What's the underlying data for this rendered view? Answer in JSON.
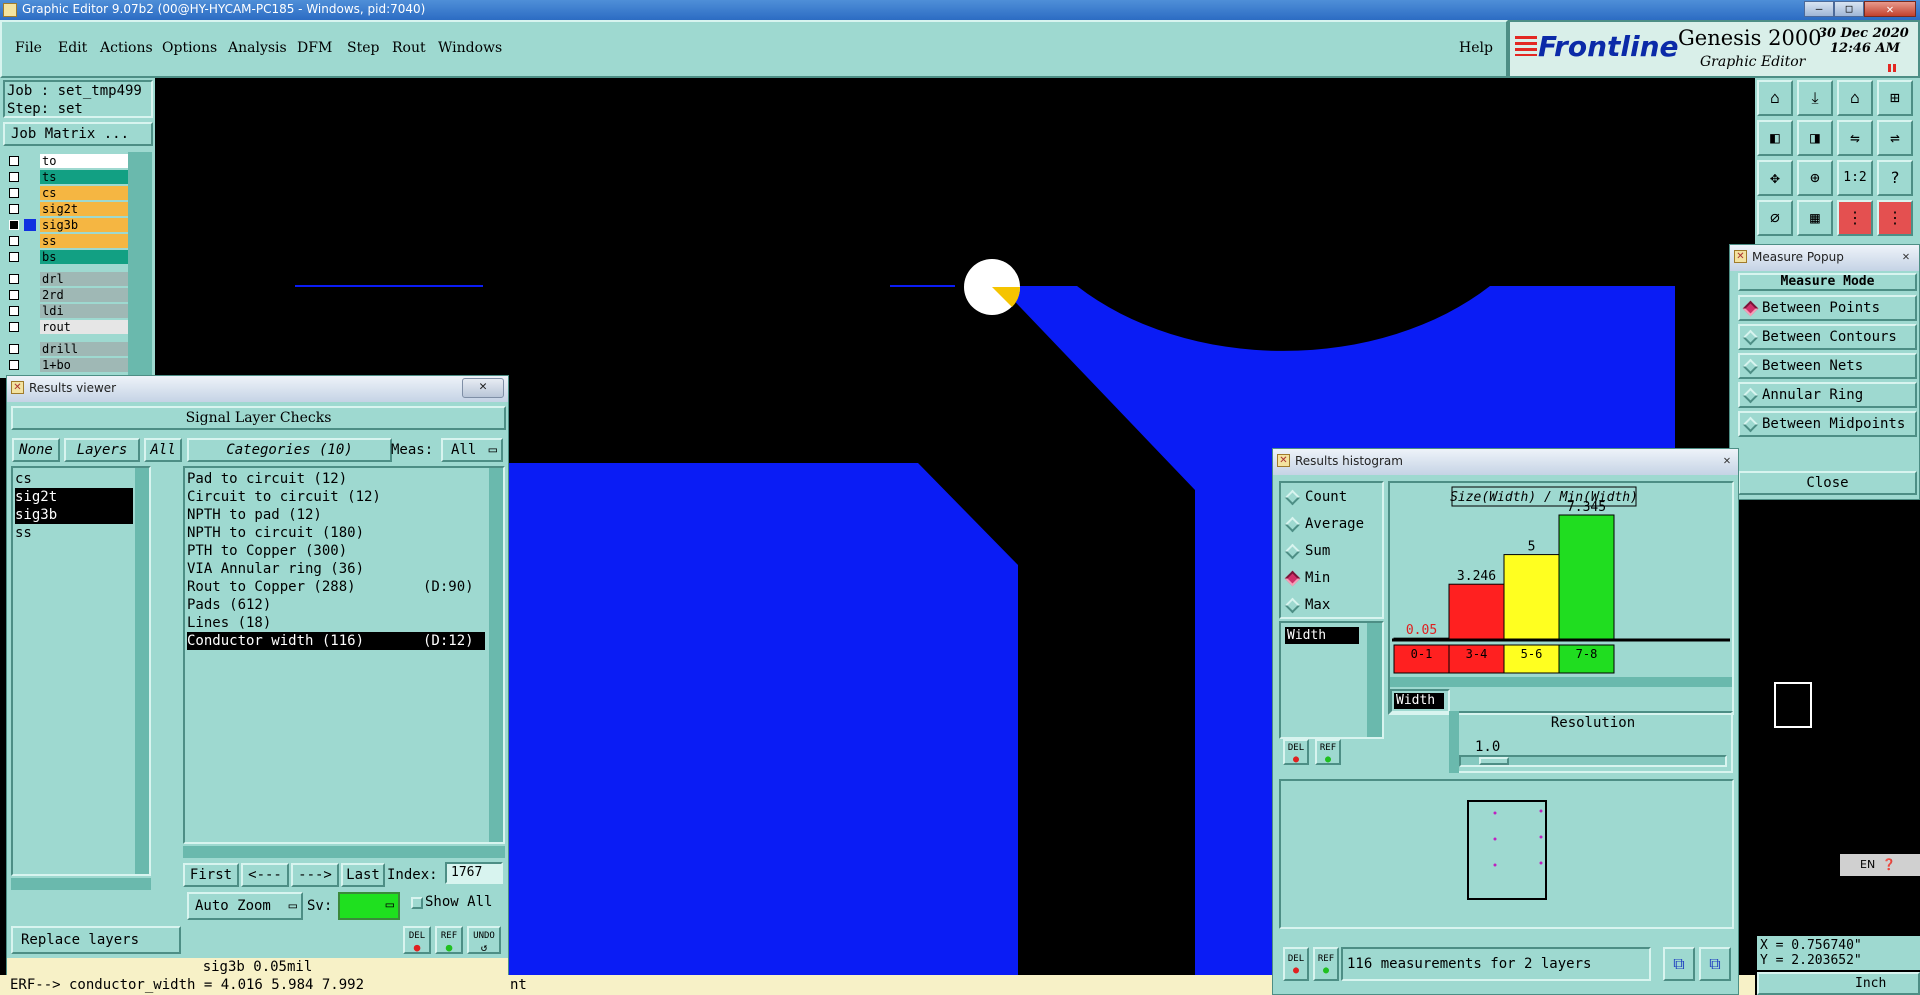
{
  "window_title": "Graphic Editor 9.07b2 (00@HY-HYCAM-PC185 - Windows, pid:7040)",
  "menu": [
    "File",
    "Edit",
    "Actions",
    "Options",
    "Analysis",
    "DFM",
    "Step",
    "Rout",
    "Windows"
  ],
  "help_label": "Help",
  "brand": {
    "logo": "Frontline",
    "product": "Genesis 2000",
    "subtitle": "Graphic Editor",
    "date": "30 Dec 2020",
    "time": "12:46 AM"
  },
  "job": {
    "job_label": "Job : set_tmp499",
    "step_label": "Step: set",
    "matrix_button": "Job Matrix ..."
  },
  "layers": [
    {
      "name": "to",
      "color": "#ffffff"
    },
    {
      "name": "ts",
      "color": "#12a083"
    },
    {
      "name": "cs",
      "color": "#f5b642"
    },
    {
      "name": "sig2t",
      "color": "#f5b642"
    },
    {
      "name": "sig3b",
      "color": "#f5b642",
      "active": true
    },
    {
      "name": "ss",
      "color": "#f5b642"
    },
    {
      "name": "bs",
      "color": "#12a083"
    },
    {
      "name": "drl",
      "color": "#9fb8b5"
    },
    {
      "name": "2rd",
      "color": "#9fb8b5"
    },
    {
      "name": "ldi",
      "color": "#9fb8b5"
    },
    {
      "name": "rout",
      "color": "#e6e6e6"
    },
    {
      "name": "drill",
      "color": "#9fb8b5"
    },
    {
      "name": "1+bo",
      "color": "#9fb8b5"
    }
  ],
  "results_viewer": {
    "title": "Results viewer",
    "header": "Signal Layer Checks",
    "none_btn": "None",
    "layers_btn": "Layers",
    "all_btn": "All",
    "categories_btn": "Categories (10)",
    "meas_label": "Meas:",
    "meas_value": "All",
    "layer_list": [
      "cs",
      "sig2t",
      "sig3b",
      "ss"
    ],
    "categories": [
      {
        "label": "Pad to circuit (12)",
        "extra": ""
      },
      {
        "label": "Circuit to circuit (12)",
        "extra": ""
      },
      {
        "label": "NPTH to pad (12)",
        "extra": ""
      },
      {
        "label": "NPTH to circuit (180)",
        "extra": ""
      },
      {
        "label": "PTH to Copper (300)",
        "extra": ""
      },
      {
        "label": "VIA Annular ring (36)",
        "extra": ""
      },
      {
        "label": "Rout to Copper (288)",
        "extra": "(D:90)"
      },
      {
        "label": "Pads (612)",
        "extra": ""
      },
      {
        "label": "Lines (18)",
        "extra": ""
      },
      {
        "label": "Conductor width (116)",
        "extra": "(D:12)"
      }
    ],
    "first": "First",
    "prev": "<---",
    "next": "--->",
    "last": "Last",
    "index_label": "Index:",
    "index_value": "1767",
    "replace_btn": "Replace layers",
    "autozoom_btn": "Auto Zoom",
    "sv_label": "Sv:",
    "show_all": "Show All",
    "del": "DEL",
    "ref": "REF",
    "undo": "UNDO",
    "status": "sig3b 0.05mil"
  },
  "bottom_msg": "ERF--> conductor_width = 4.016 5.984 7.992",
  "bottom_msg2": "nt",
  "measure_popup": {
    "title": "Measure Popup",
    "header": "Measure Mode",
    "modes": [
      {
        "label": "Between Points",
        "on": true
      },
      {
        "label": "Between Contours",
        "on": false
      },
      {
        "label": "Between Nets",
        "on": false
      },
      {
        "label": "Annular Ring",
        "on": false
      },
      {
        "label": "Between Midpoints",
        "on": false
      }
    ],
    "close": "Close"
  },
  "histogram": {
    "title": "Results histogram",
    "modes": [
      {
        "label": "Count",
        "on": false
      },
      {
        "label": "Average",
        "on": false
      },
      {
        "label": "Sum",
        "on": false
      },
      {
        "label": "Min",
        "on": true
      },
      {
        "label": "Max",
        "on": false
      }
    ],
    "attr_item": "Width",
    "attr_item2": "Width",
    "resolution_label": "Resolution",
    "resolution_value": "1.0",
    "summary": "116 measurements for 2 layers",
    "del": "DEL",
    "ref": "REF"
  },
  "chart_data": {
    "type": "bar",
    "title": "Size(Width) / Min(Width)",
    "categories": [
      "0-1",
      "3-4",
      "5-6",
      "7-8"
    ],
    "values": [
      0.05,
      3.246,
      5,
      7.345
    ],
    "value_labels": [
      "0.05",
      "3.246",
      "5",
      "7.345"
    ],
    "colors": [
      "#ff2020",
      "#ff2020",
      "#ffff20",
      "#20dd20"
    ],
    "ylim": [
      0,
      7.345
    ]
  },
  "coords": {
    "x": "X = 0.756740\"",
    "y": "Y = 2.203652\"",
    "units": "Inch"
  },
  "lang": "EN",
  "colors": {
    "panel": "#9ed9d0",
    "copper": "#0a1cf5",
    "highlight": "#f5c400"
  }
}
